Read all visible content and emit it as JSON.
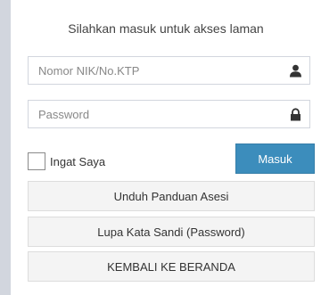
{
  "login": {
    "message": "Silahkan masuk untuk akses laman",
    "nik_placeholder": "Nomor NIK/No.KTP",
    "password_placeholder": "Password",
    "remember_label": "Ingat Saya",
    "submit_label": "Masuk",
    "guide_button": "Unduh Panduan Asesi",
    "forgot_button": "Lupa Kata Sandi (Password)",
    "back_button": "KEMBALI KE BERANDA"
  },
  "icons": {
    "nik": "user-icon",
    "password": "lock-icon"
  },
  "colors": {
    "page_background": "#d2d6de",
    "primary": "#3c8dbc",
    "default_button": "#f4f4f4",
    "input_border": "#d2d6de"
  }
}
